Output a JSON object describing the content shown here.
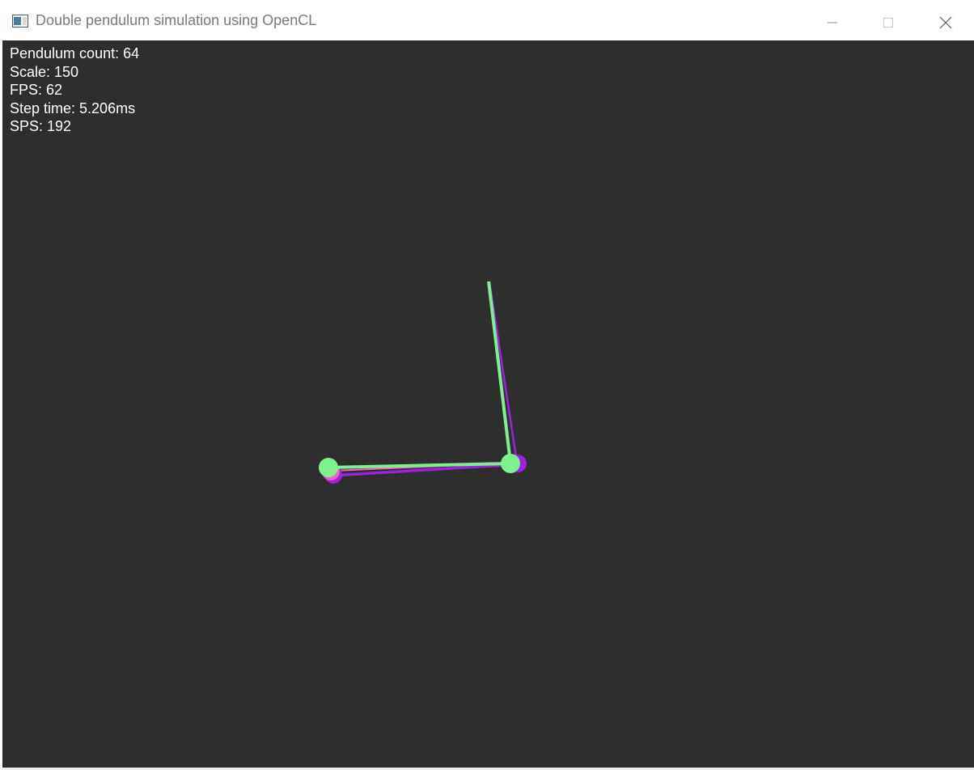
{
  "window": {
    "title": "Double pendulum simulation using OpenCL",
    "controls": [
      "minimize-icon",
      "maximize-icon",
      "close-icon"
    ]
  },
  "hud": {
    "pendulum_count": "Pendulum count: 64",
    "scale": "Scale: 150",
    "fps": "FPS: 62",
    "step_time": "Step time: 5.206ms",
    "sps": "SPS: 192"
  },
  "colors": {
    "background": "#2e2e2e",
    "pendulum_primary": "#7ef08e",
    "pendulum_purple": "#a020e0",
    "pendulum_pink": "#f060c0",
    "pendulum_cyan": "#40c0e0"
  }
}
